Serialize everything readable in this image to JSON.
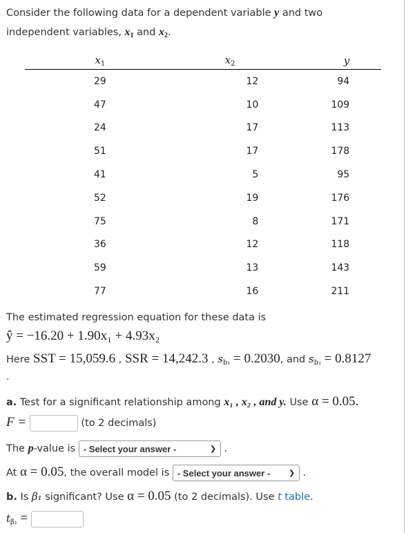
{
  "intro": {
    "line1_text": "Consider the following data for a dependent variable",
    "line1_var": "y",
    "line1_end": "and two",
    "line2_text": "independent variables,",
    "line2_var1": "x",
    "line2_var1_sub": "1",
    "line2_and": "and",
    "line2_var2": "x",
    "line2_var2_sub": "2",
    "line2_end": "."
  },
  "table": {
    "headers": [
      {
        "var": "x",
        "sub": "1"
      },
      {
        "var": "x",
        "sub": "2"
      },
      {
        "var": "y",
        "sub": ""
      }
    ],
    "rows": [
      [
        "29",
        "12",
        "94"
      ],
      [
        "47",
        "10",
        "109"
      ],
      [
        "24",
        "17",
        "113"
      ],
      [
        "51",
        "17",
        "178"
      ],
      [
        "41",
        "5",
        "95"
      ],
      [
        "52",
        "19",
        "176"
      ],
      [
        "75",
        "8",
        "171"
      ],
      [
        "36",
        "12",
        "118"
      ],
      [
        "59",
        "13",
        "143"
      ],
      [
        "77",
        "16",
        "211"
      ]
    ]
  },
  "regression": {
    "intro": "The estimated regression equation for these data is",
    "equation": "ŷ = −16.20 + 1.90x₁ + 4.93x₂",
    "here": "Here",
    "sst": "SST = 15,059.6",
    "ssr": "SSR = 14,242.3",
    "sb1_label": "s",
    "sb1_sub": "b₁",
    "sb1_value": "= 0.2030",
    "and": ", and",
    "sb2_label": "s",
    "sb2_sub": "b₂",
    "sb2_value": "= 0.8127",
    "trailing_dot": "."
  },
  "part_a": {
    "label": "a.",
    "text": "Test for a significant relationship among",
    "vars": "x₁ , x₂ , and y.",
    "use": "Use",
    "alpha": "α = 0.05.",
    "f_label": "F =",
    "f_value": "",
    "f_hint": "(to 2 decimals)",
    "pvalue_prefix": "The",
    "pvalue_p": "p",
    "pvalue_suffix": "-value is",
    "pvalue_select": "- Select your answer -",
    "pvalue_end": ".",
    "model_prefix": "At",
    "model_alpha": "α = 0.05",
    "model_text": ", the overall model is",
    "model_select": "- Select your answer -",
    "model_end": "."
  },
  "part_b": {
    "label": "b.",
    "text1": "Is",
    "beta": "β₁",
    "text2": "significant? Use",
    "alpha": "α = 0.05",
    "text3": "(to 2 decimals). Use",
    "link_t": "t",
    "link_table": "table",
    "end": ".",
    "t_label": "t",
    "t_sub": "β₁",
    "t_eq": "=",
    "t_value": ""
  },
  "colors": {
    "link": "#1a6fb5",
    "text": "#333333"
  }
}
